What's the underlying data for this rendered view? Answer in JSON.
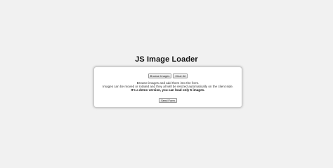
{
  "title": "JS Image Loader",
  "form": {
    "browse_label": "Browse Images",
    "clear_label": "Clear All",
    "line1": "Browse images and add them into the form.",
    "line2": "Images can be moved or rotated and they all will be resized automatically on the client side.",
    "line3": "It's a demo version, you can load only 5 images.",
    "send_label": "Send Form"
  },
  "colors": {
    "page_background": "#f1f1f1",
    "panel_background": "#ffffff",
    "panel_border": "#c9c9c9"
  }
}
